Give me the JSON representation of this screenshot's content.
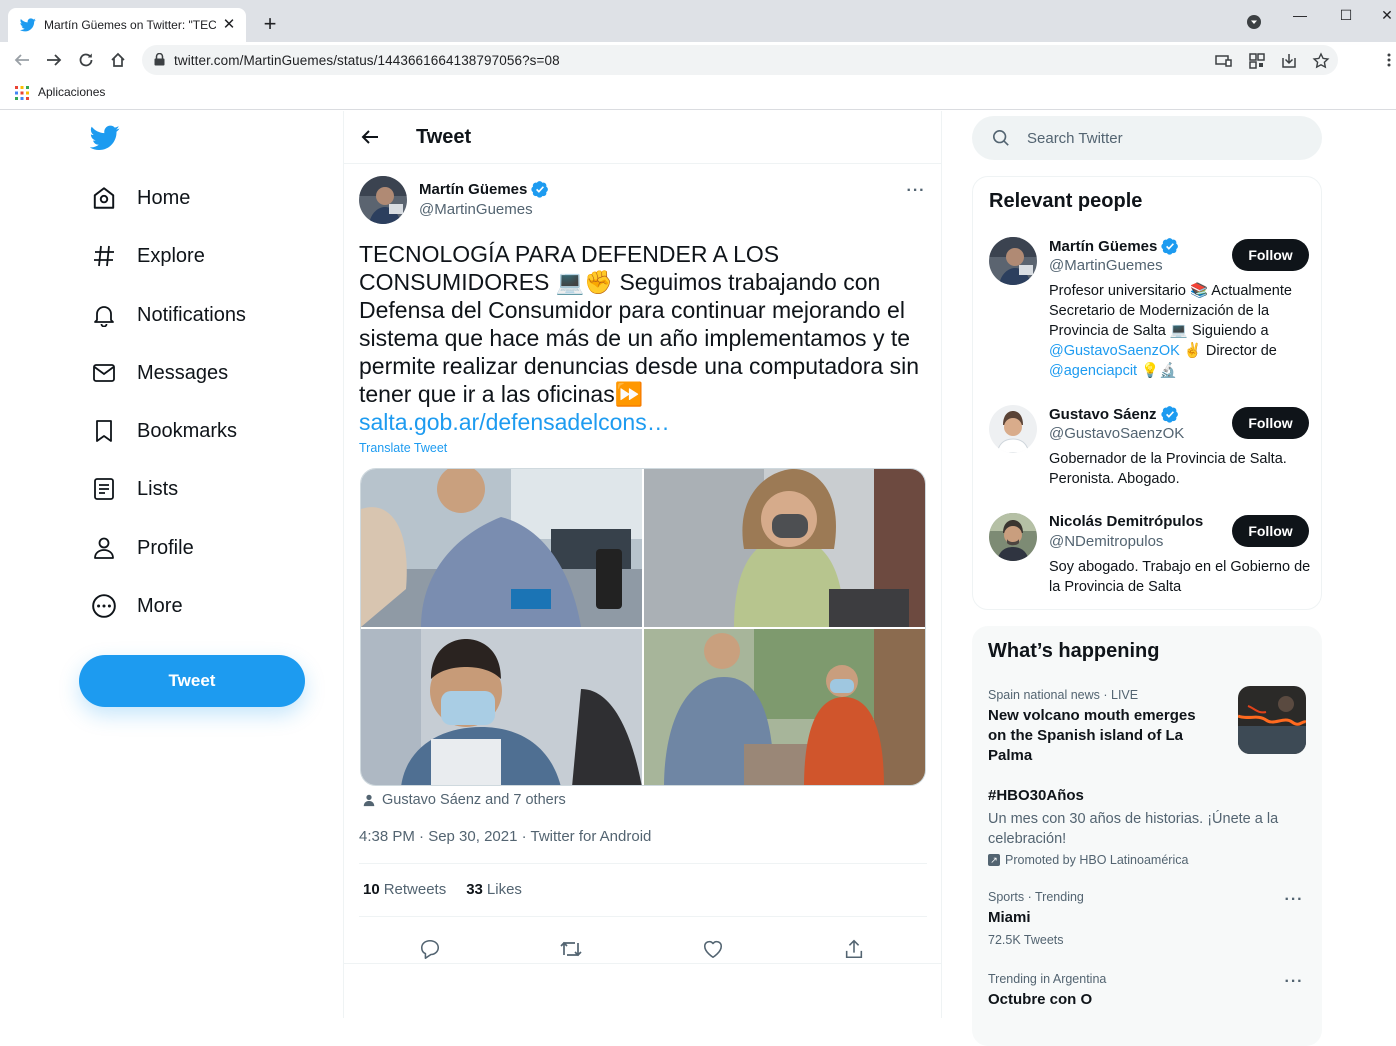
{
  "browser": {
    "tab_title": "Martín Güemes on Twitter: \"TECNOLOGÍA PARA DEFENDER A LOS CONSUMIDORES",
    "tab_close": "✕",
    "new_tab": "+",
    "url": "twitter.com/MartinGuemes/status/1443661664138797056?s=08",
    "bookmark_apps": "Aplicaciones",
    "window_minimize": "—",
    "window_maximize": "☐"
  },
  "nav": {
    "items": [
      {
        "label": "Home",
        "icon": "home-icon"
      },
      {
        "label": "Explore",
        "icon": "hashtag-icon"
      },
      {
        "label": "Notifications",
        "icon": "bell-icon"
      },
      {
        "label": "Messages",
        "icon": "envelope-icon"
      },
      {
        "label": "Bookmarks",
        "icon": "bookmark-icon"
      },
      {
        "label": "Lists",
        "icon": "list-icon"
      },
      {
        "label": "Profile",
        "icon": "person-icon"
      },
      {
        "label": "More",
        "icon": "more-circle-icon"
      }
    ],
    "tweet_button": "Tweet"
  },
  "main": {
    "header_title": "Tweet",
    "author": {
      "name": "Martín Güemes",
      "handle": "@MartinGuemes"
    },
    "text": "TECNOLOGÍA PARA DEFENDER A LOS CONSUMIDORES 💻✊ Seguimos trabajando con Defensa del Consumidor para continuar mejorando el sistema que hace más de un año implementamos y te permite realizar denuncias desde una computadora sin tener que ir a las oficinas⏩",
    "link": "salta.gob.ar/defensadelcons…",
    "translate": "Translate Tweet",
    "tagged": "Gustavo Sáenz and 7 others",
    "timestamp": "4:38 PM · Sep 30, 2021 · Twitter for Android",
    "retweets_count": "10",
    "retweets_label": "Retweets",
    "likes_count": "33",
    "likes_label": "Likes"
  },
  "sidebar": {
    "search_placeholder": "Search Twitter",
    "relevant_title": "Relevant people",
    "people": [
      {
        "name": "Martín Güemes",
        "handle": "@MartinGuemes",
        "follow": "Follow",
        "bio_1": "Profesor universitario 📚 Actualmente Secretario de Modernización de la Provincia de Salta 💻 Siguiendo a ",
        "mention_1": "@GustavoSaenzOK",
        "bio_2": " ✌️ Director de ",
        "mention_2": "@agenciapcit",
        "bio_3": " 💡🔬"
      },
      {
        "name": "Gustavo Sáenz",
        "handle": "@GustavoSaenzOK",
        "follow": "Follow",
        "bio": "Gobernador de la Provincia de Salta. Peronista. Abogado."
      },
      {
        "name": "Nicolás Demitrópulos",
        "handle": "@NDemitropulos",
        "follow": "Follow",
        "bio": "Soy abogado. Trabajo en el Gobierno de la Provincia de Salta"
      }
    ],
    "happening_title": "What’s happening",
    "trends": [
      {
        "meta": "Spain national news · LIVE",
        "title": "New volcano mouth emerges on the Spanish island of La Palma"
      },
      {
        "title": "#HBO30Años",
        "desc": " Un mes con 30 años de historias. ¡Únete a la celebración!",
        "promo": "Promoted by HBO Latinoamérica"
      },
      {
        "meta": "Sports · Trending",
        "title": "Miami",
        "count": "72.5K Tweets"
      },
      {
        "meta": "Trending in Argentina",
        "title": "Octubre con O"
      }
    ]
  },
  "colors": {
    "accent": "#1d9bf0",
    "text": "#0f1419",
    "muted": "#536471"
  }
}
